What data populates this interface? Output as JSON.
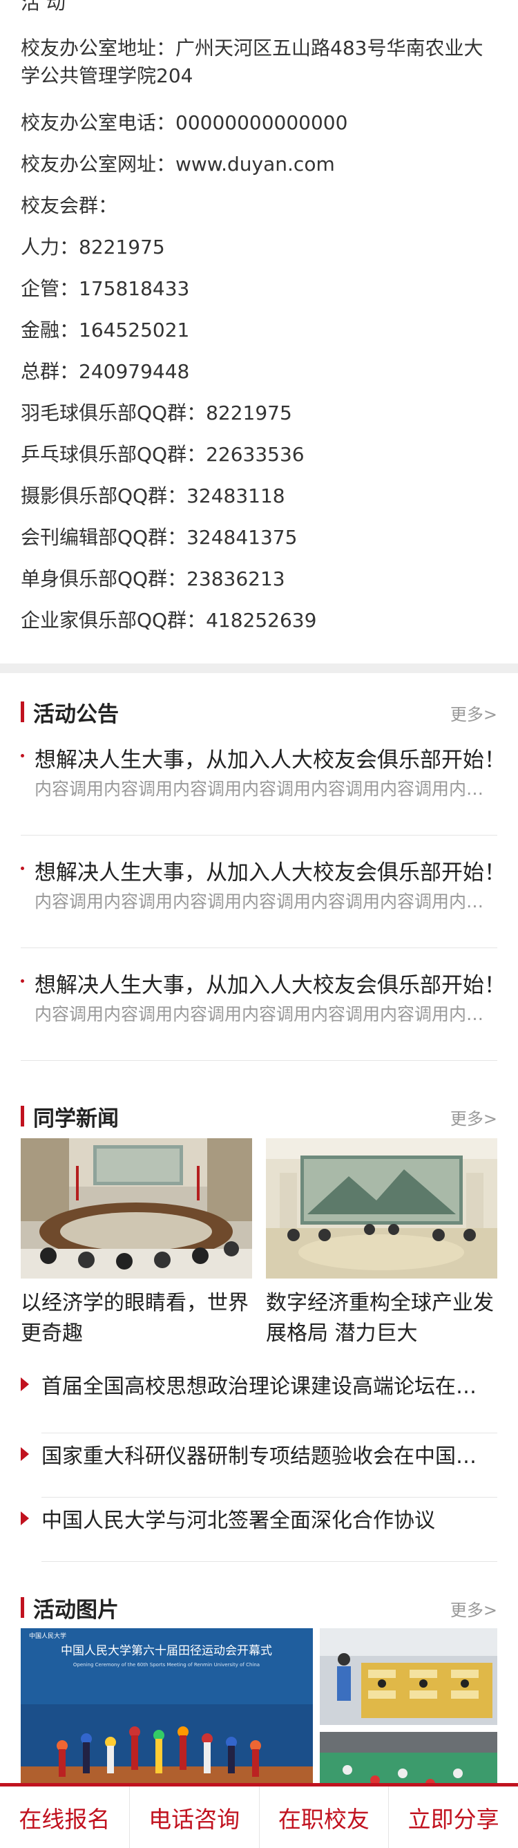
{
  "contact": {
    "cutoff_text": "活 动",
    "address": "校友办公室地址：广州天河区五山路483号华南农业大学公共管理学院204",
    "lines": [
      "校友办公室电话：00000000000000",
      "校友办公室网址：www.duyan.com",
      "校友会群：",
      "人力：8221975",
      "企管：175818433",
      "金融：164525021",
      "总群：240979448",
      "羽毛球俱乐部QQ群：8221975",
      "乒乓球俱乐部QQ群：22633536",
      "摄影俱乐部QQ群：32483118",
      "会刊编辑部QQ群：324841375",
      "单身俱乐部QQ群：23836213",
      "企业家俱乐部QQ群：418252639"
    ]
  },
  "notices": {
    "title": "活动公告",
    "more": "更多>",
    "items": [
      {
        "title": "想解决人生大事，从加入人大校友会俱乐部开始！",
        "desc": "内容调用内容调用内容调用内容调用内容调用内容调用内容调用"
      },
      {
        "title": "想解决人生大事，从加入人大校友会俱乐部开始！",
        "desc": "内容调用内容调用内容调用内容调用内容调用内容调用内容调用"
      },
      {
        "title": "想解决人生大事，从加入人大校友会俱乐部开始！",
        "desc": "内容调用内容调用内容调用内容调用内容调用内容调用内容调用"
      }
    ]
  },
  "news": {
    "title": "同学新闻",
    "more": "更多>",
    "cards": [
      {
        "caption": "以经济学的眼睛看，世界更奇趣"
      },
      {
        "caption": "数字经济重构全球产业发展格局 潜力巨大"
      }
    ],
    "list": [
      "首届全国高校思想政治理论课建设高端论坛在中国人民大学举行",
      "国家重大科研仪器研制专项结题验收会在中国人民大学召开",
      "中国人民大学与河北签署全面深化合作协议"
    ]
  },
  "photos": {
    "title": "活动图片",
    "more": "更多>",
    "banner_cn": "中国人民大学第六十届田径运动会开幕式",
    "banner_en": "Opening Ceremony of the 60th Sports Meeting of Renmin University of China",
    "logo_text": "中国人民大学"
  },
  "bottom_bar": [
    "在线报名",
    "电话咨询",
    "在职校友",
    "立即分享"
  ],
  "colors": {
    "accent": "#c1121f",
    "muted": "#999999",
    "divider": "#e5e5e5",
    "gap": "#eeeeee"
  }
}
